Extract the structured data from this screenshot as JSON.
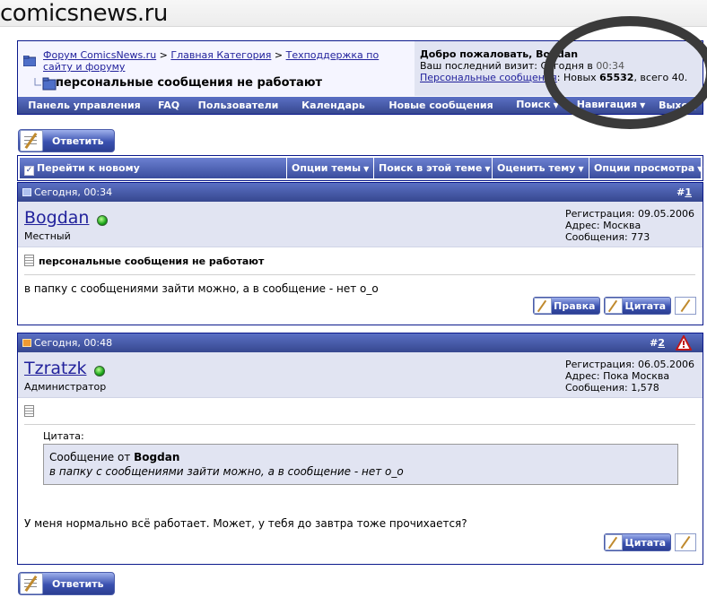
{
  "site": {
    "name": "comicsnews.ru"
  },
  "header": {
    "breadcrumb": [
      "Форум ComicsNews.ru",
      "Главная Категория",
      "Техподдержка по",
      "сайту и форуму"
    ],
    "separator": ">",
    "page_title": "персональные сообщения не работают",
    "welcome": "Добро пожаловать, Bogdan",
    "last_visit_label": "Ваш последний визит: Сегодня в",
    "last_visit_time": "00:34",
    "pm_link": "Персональные сообщения",
    "pm_new_label": ": Новых",
    "pm_new_count": "65532",
    "pm_total": ", всего 40."
  },
  "navbar": {
    "items": [
      "Панель управления",
      "FAQ",
      "Пользователи",
      "Календарь",
      "Новые сообщения",
      "Поиск",
      "Навигация",
      "Выход"
    ]
  },
  "reply_button": "Ответить",
  "tools": {
    "goto_new": "Перейти к новому",
    "items": [
      "Опции темы",
      "Поиск в этой теме",
      "Оценить тему",
      "Опции просмотра"
    ]
  },
  "posts": [
    {
      "date": "Сегодня, 00:34",
      "number": "1",
      "username": "Bogdan",
      "user_title": "Местный",
      "reg": "Регистрация: 09.05.2006",
      "address": "Адрес: Москва",
      "messages": "Сообщения: 773",
      "title": "персональные сообщения не работают",
      "text": "в папку с сообщениями зайти можно, а в сообщение - нет о_о",
      "edit_label": "Правка",
      "quote_label": "Цитата"
    },
    {
      "date": "Сегодня, 00:48",
      "number": "2",
      "username": "Tzratzk",
      "user_title": "Администратор",
      "reg": "Регистрация: 06.05.2006",
      "address": "Адрес: Пока Москва",
      "messages": "Сообщения: 1,578",
      "quote_header": "Цитата:",
      "quote_from_label": "Сообщение от",
      "quote_author": "Bogdan",
      "quote_text": "в папку с сообщениями зайти можно, а в сообщение - нет о_о",
      "text": "У меня нормально всё работает. Может, у тебя до завтра тоже прочихается?",
      "quote_label": "Цитата"
    }
  ],
  "colors": {
    "border": "#0b198c",
    "header_grad_top": "#5b70c4",
    "header_grad_bottom": "#36478f",
    "panel": "#e1e4f2",
    "link": "#22229c"
  }
}
